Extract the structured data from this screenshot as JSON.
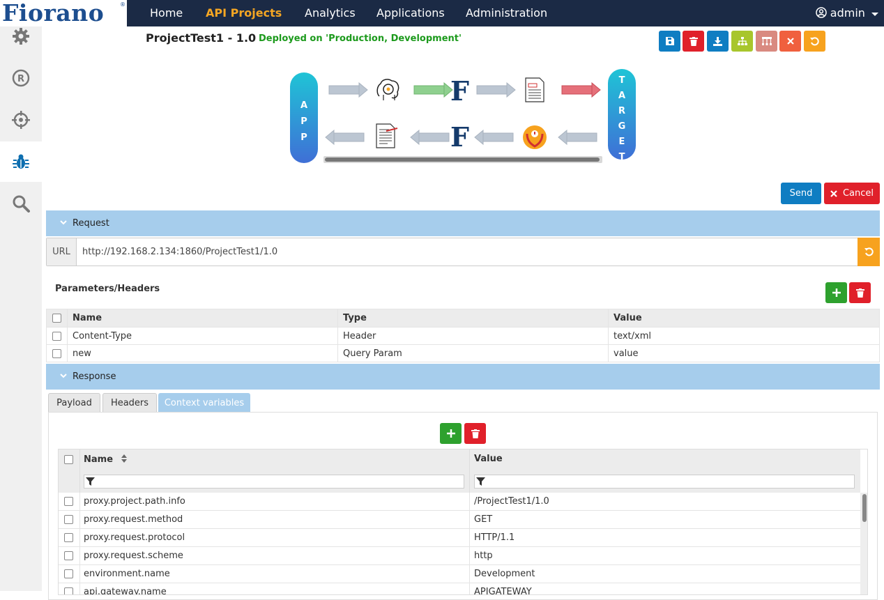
{
  "brand": {
    "logo_text": "Fiorano",
    "reg_mark": "®"
  },
  "nav": {
    "items": [
      {
        "label": "Home"
      },
      {
        "label": "API Projects",
        "active": true
      },
      {
        "label": "Analytics"
      },
      {
        "label": "Applications"
      },
      {
        "label": "Administration"
      }
    ],
    "user": "admin"
  },
  "rail": {
    "icons": [
      "gear-icon",
      "registered-icon",
      "target-icon",
      "bug-icon",
      "search-icon"
    ],
    "active": "bug-icon"
  },
  "project": {
    "title": "ProjectTest1 - 1.0",
    "deployed": "Deployed on 'Production, Development'"
  },
  "toolbar": {
    "buttons": [
      {
        "icon": "save-icon",
        "color": "#0f7dc2"
      },
      {
        "icon": "trash-icon",
        "color": "#e0202a"
      },
      {
        "icon": "download-icon",
        "color": "#0f7dc2"
      },
      {
        "icon": "sitemap-icon",
        "color": "#a8c62c"
      },
      {
        "icon": "hierarchy-icon",
        "color": "#d98a80"
      },
      {
        "icon": "close-icon",
        "color": "#f0603e"
      },
      {
        "icon": "undo-icon",
        "color": "#f7a21e"
      }
    ]
  },
  "flow": {
    "app_label": "A P P",
    "target_label": "T A R G E T"
  },
  "actions": {
    "send": "Send",
    "cancel": "Cancel"
  },
  "request": {
    "section_label": "Request",
    "url_label": "URL",
    "url": "http://192.168.2.134:1860/ProjectTest1/1.0",
    "params_title": "Parameters/Headers",
    "columns": [
      "Name",
      "Type",
      "Value"
    ],
    "rows": [
      {
        "name": "Content-Type",
        "type": "Header",
        "value": "text/xml"
      },
      {
        "name": "new",
        "type": "Query Param",
        "value": "value"
      }
    ]
  },
  "response": {
    "section_label": "Response",
    "tabs": [
      {
        "label": "Payload"
      },
      {
        "label": "Headers"
      },
      {
        "label": "Context variables",
        "active": true
      }
    ],
    "columns": [
      "Name",
      "Value"
    ],
    "rows": [
      {
        "name": "proxy.project.path.info",
        "value": "/ProjectTest1/1.0"
      },
      {
        "name": "proxy.request.method",
        "value": "GET"
      },
      {
        "name": "proxy.request.protocol",
        "value": "HTTP/1.1"
      },
      {
        "name": "proxy.request.scheme",
        "value": "http"
      },
      {
        "name": "environment.name",
        "value": "Development"
      },
      {
        "name": "api.gateway.name",
        "value": "APIGATEWAY"
      }
    ]
  },
  "colors": {
    "nav_bg": "#1b2a45",
    "nav_active": "#f5a623",
    "section_bg": "#a6cdec",
    "add_green": "#2ea12e",
    "delete_red": "#e0202a",
    "send_blue": "#0f7dc2"
  }
}
